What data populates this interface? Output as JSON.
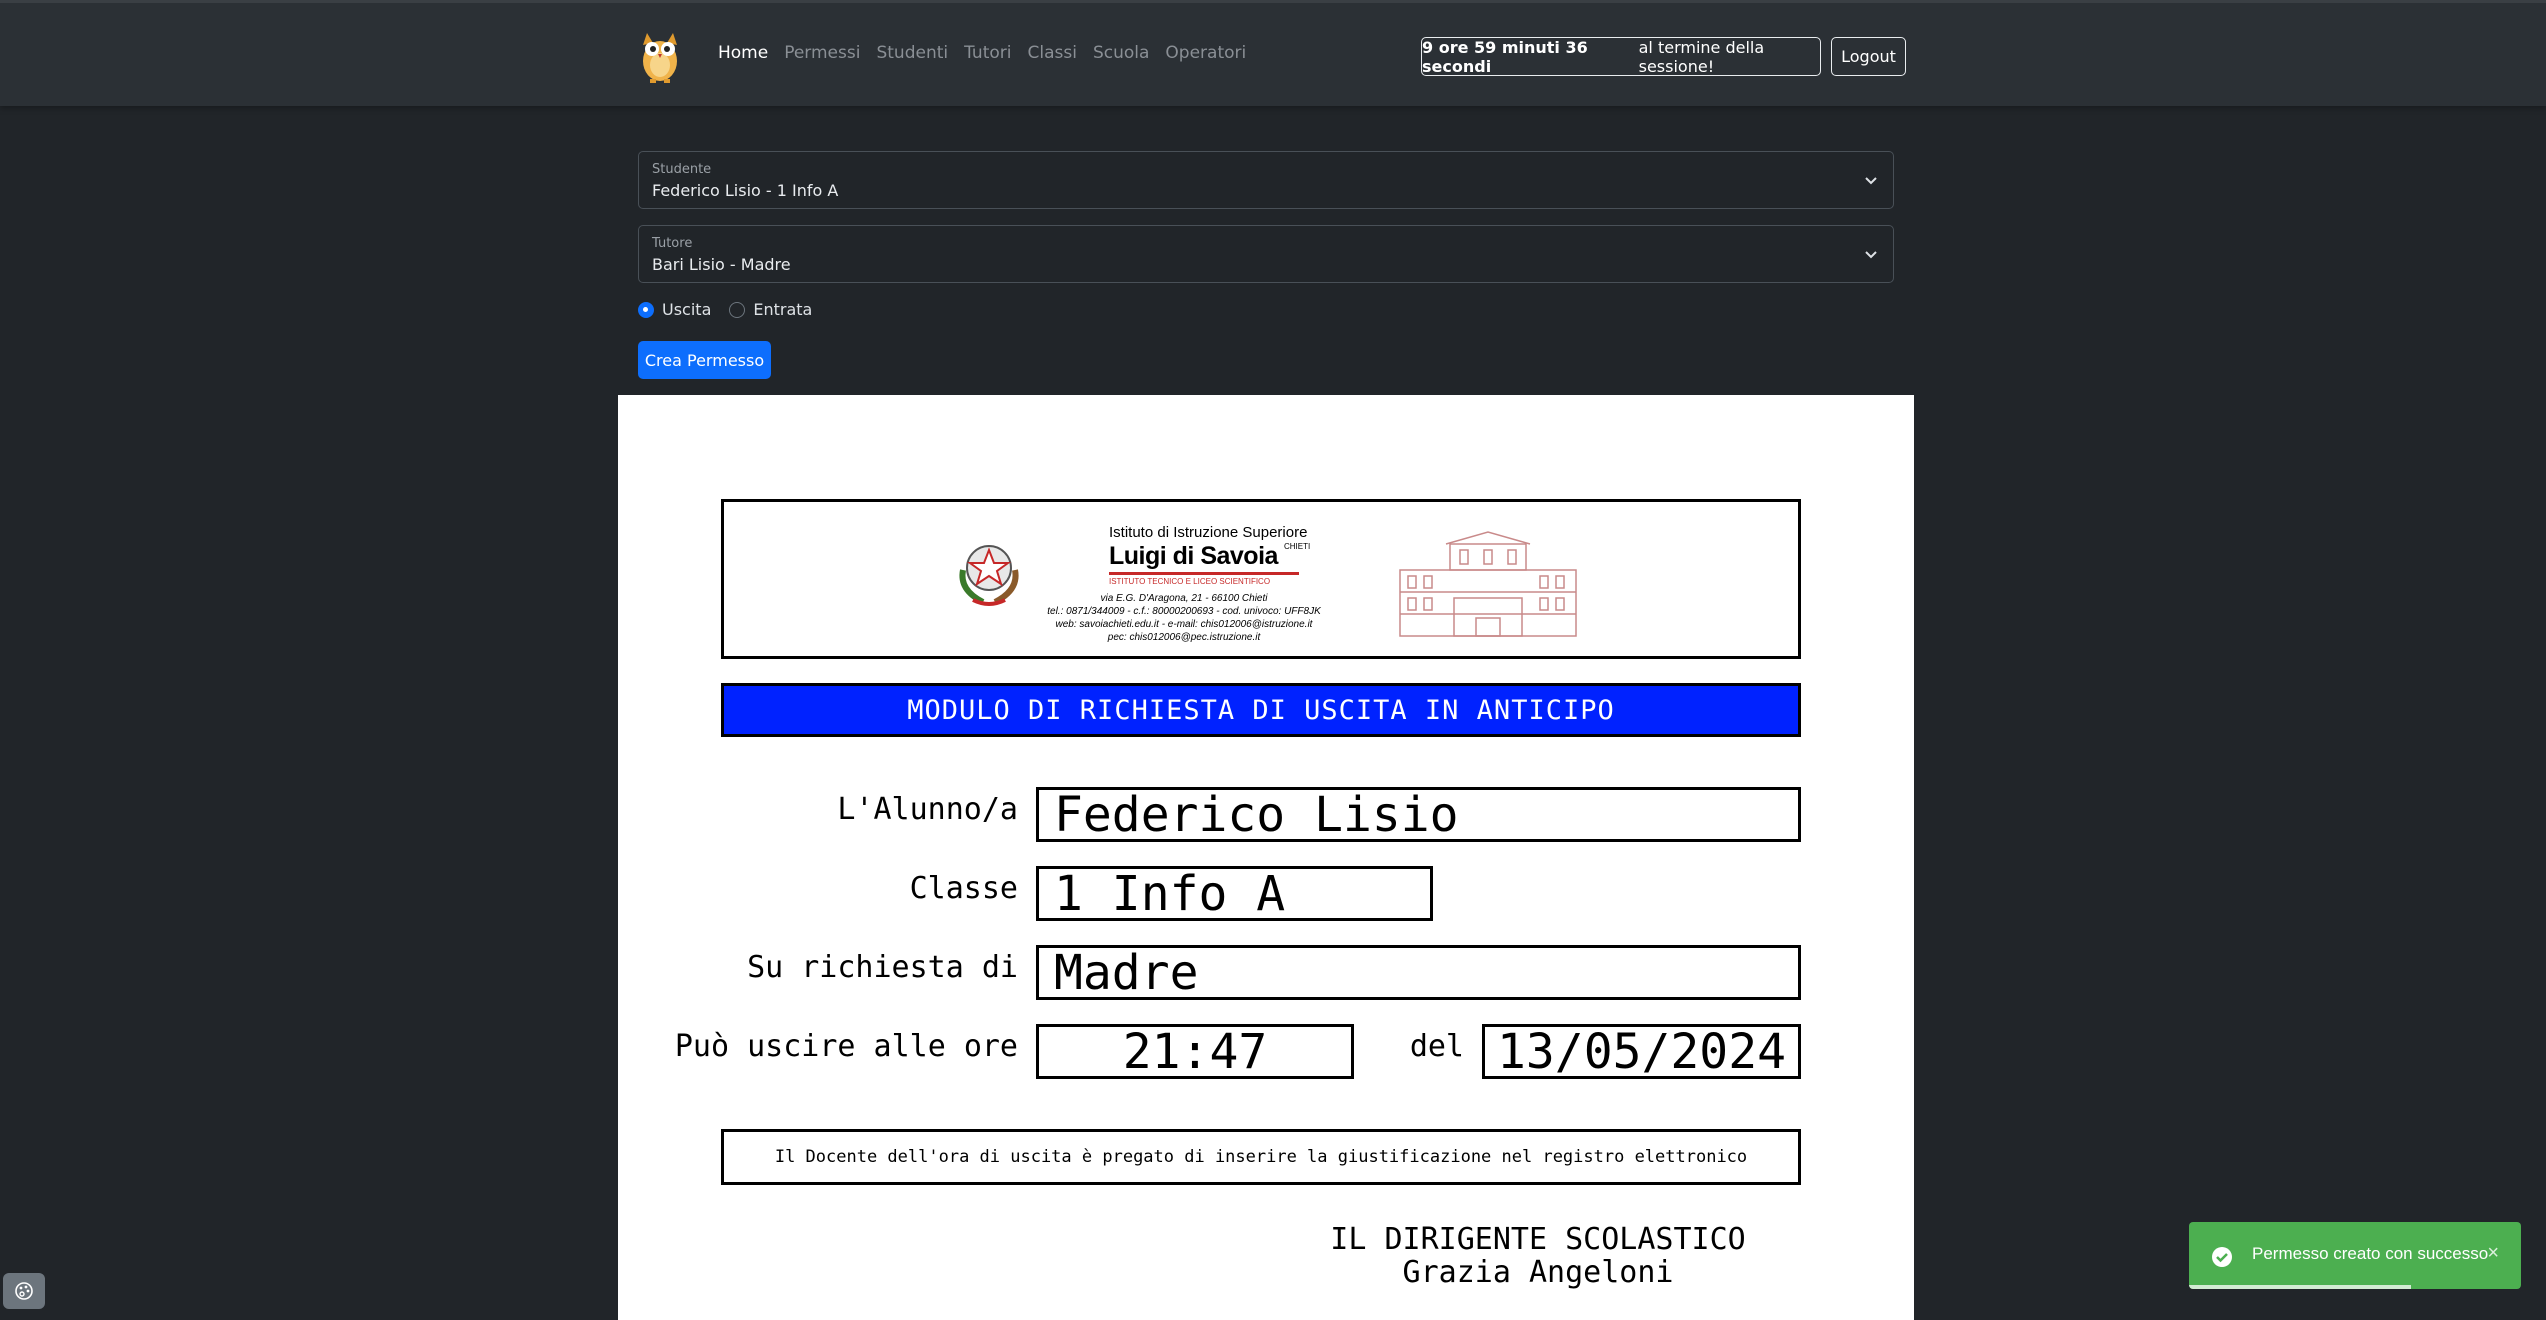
{
  "nav": {
    "items": [
      {
        "label": "Home",
        "active": true
      },
      {
        "label": "Permessi"
      },
      {
        "label": "Studenti"
      },
      {
        "label": "Tutori"
      },
      {
        "label": "Classi"
      },
      {
        "label": "Scuola"
      },
      {
        "label": "Operatori"
      }
    ],
    "session_time": "9 ore 59 minuti 36 secondi",
    "session_suffix": "al termine della sessione!",
    "logout_label": "Logout",
    "brand_icon": "owl-mascot-icon"
  },
  "form": {
    "student_label": "Studente",
    "student_value": "Federico Lisio - 1 Info A",
    "tutor_label": "Tutore",
    "tutor_value": "Bari Lisio - Madre",
    "radio_exit": "Uscita",
    "radio_entry": "Entrata",
    "selected": "Uscita",
    "submit_label": "Crea Permesso"
  },
  "document": {
    "letterhead": {
      "line1": "Istituto di Istruzione Superiore",
      "name": "Luigi di Savoia",
      "city_small": "CHIETI",
      "subtitle": "ISTITUTO TECNICO E LICEO SCIENTIFICO",
      "address": "via E.G. D'Aragona, 21 - 66100 Chieti",
      "phone": "tel.: 0871/344009 - c.f.: 80000200693 - cod. univoco: UFF8JK",
      "web": "web: savoiachieti.edu.it - e-mail: chis012006@istruzione.it",
      "pec": "pec: chis012006@pec.istruzione.it"
    },
    "title": "MODULO DI RICHIESTA DI USCITA IN ANTICIPO",
    "student_label": "L'Alunno/a",
    "student_value": "Federico Lisio",
    "class_label": "Classe",
    "class_value": "1 Info A",
    "request_label": "Su richiesta di",
    "request_value": "Madre",
    "time_label": "Può uscire alle ore",
    "time_value": "21:47",
    "date_label": "del",
    "date_value": "13/05/2024",
    "note": "Il Docente dell'ora di uscita è pregato di inserire la giustificazione nel registro elettronico",
    "signature_title": "IL DIRIGENTE SCOLASTICO",
    "signature_name": "Grazia Angeloni"
  },
  "toast": {
    "message": "Permesso creato con successo",
    "close": "×",
    "progress": 0.67,
    "color": "#4caf50"
  },
  "colors": {
    "background": "#212529",
    "navbar": "#2b3035",
    "primary": "#0d6efd",
    "doc_title_bar": "#0022ff"
  }
}
